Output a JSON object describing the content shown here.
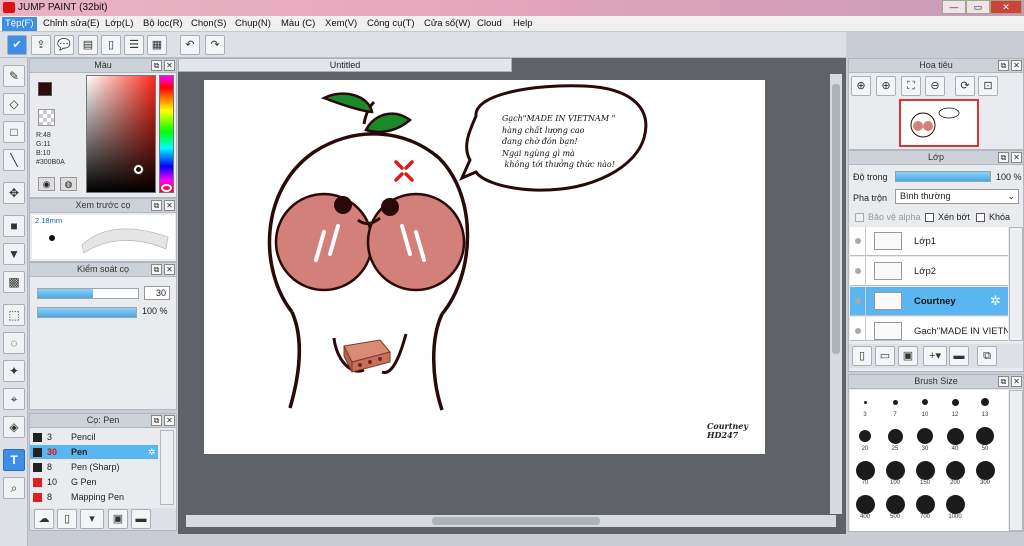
{
  "app": {
    "title": "JUMP PAINT (32bit)"
  },
  "window": {
    "min": "—",
    "max": "▭",
    "close": "✕"
  },
  "menu": [
    "Tệp(F)",
    "Chỉnh sửa(E)",
    "Lớp(L)",
    "Bộ lọc(R)",
    "Chọn(S)",
    "Chụp(N)",
    "Màu (C)",
    "Xem(V)",
    "Công cụ(T)",
    "Cửa sổ(W)",
    "Cloud",
    "Help"
  ],
  "color_panel": {
    "title": "Màu",
    "r": "R:48",
    "g": "G:11",
    "b": "B:10",
    "hex": "#300B0A",
    "primary_color": "#300B0A"
  },
  "brush_preview": {
    "title": "Xem trước cọ",
    "size": "2.18mm"
  },
  "brush_control": {
    "title": "Kiểm soát cọ",
    "size_value": "30",
    "opacity_value": "100 %",
    "size_fill": 0.55,
    "opacity_fill": 1.0
  },
  "brush_list": {
    "title": "Cọ: Pen",
    "items": [
      {
        "size": "3",
        "name": "Pencil",
        "color": "#222222"
      },
      {
        "size": "30",
        "name": "Pen",
        "color": "#222222",
        "selected": true
      },
      {
        "size": "8",
        "name": "Pen (Sharp)",
        "color": "#222222"
      },
      {
        "size": "10",
        "name": "G Pen",
        "color": "#e02020"
      },
      {
        "size": "8",
        "name": "Mapping Pen",
        "color": "#e02020"
      }
    ]
  },
  "document": {
    "tab": "Untitled"
  },
  "artwork": {
    "speech_lines": [
      "Gạch\"MADE IN VIETNAM \"",
      "hàng chất lượng cao",
      "đang chờ đón bạn!",
      "Ngại ngùng gì mà",
      " không tới thưởng thức nào!"
    ],
    "signature": [
      "Courtney",
      "HD247"
    ]
  },
  "navigator": {
    "title": "Hoa tiêu"
  },
  "layers": {
    "title": "Lớp",
    "opacity_label": "Độ trong",
    "opacity_value": "100 %",
    "blend_label": "Pha trộn",
    "blend_value": "Bình thường",
    "protect_alpha": "Bảo vệ alpha",
    "clipping": "Xén bớt",
    "lock": "Khóa",
    "items": [
      {
        "name": "Lớp1"
      },
      {
        "name": "Lớp2"
      },
      {
        "name": "Courtney",
        "selected": true
      },
      {
        "name": "Gạch\"MADE IN VIETNA"
      }
    ]
  },
  "brush_size": {
    "title": "Brush Size",
    "sizes": [
      "3",
      "7",
      "10",
      "12",
      "13",
      "20",
      "25",
      "30",
      "40",
      "50",
      "70",
      "100",
      "150",
      "200",
      "300",
      "400",
      "500",
      "700",
      "1000"
    ]
  }
}
